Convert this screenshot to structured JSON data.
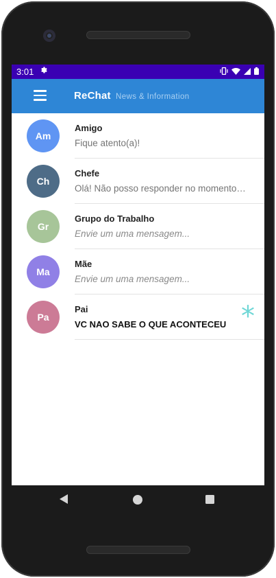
{
  "status_bar": {
    "time": "3:01",
    "settings_icon": "gear-icon",
    "icons": [
      "vibrate-icon",
      "wifi-icon",
      "signal-icon",
      "battery-icon"
    ]
  },
  "app_bar": {
    "menu_icon": "hamburger-menu-icon",
    "title": "ReChat",
    "subtitle": "News & Information",
    "color": "#2e86d6"
  },
  "chats": [
    {
      "initials": "Am",
      "name": "Amigo",
      "message": "Fique atento(a)!",
      "avatar_color": "#5f95f3",
      "style": "normal"
    },
    {
      "initials": "Ch",
      "name": "Chefe",
      "message": "Olá! Não posso responder no momento,...",
      "avatar_color": "#4e6c87",
      "style": "normal"
    },
    {
      "initials": "Gr",
      "name": "Grupo do Trabalho",
      "message": "Envie um uma mensagem...",
      "avatar_color": "#a7c599",
      "style": "italic"
    },
    {
      "initials": "Ma",
      "name": "Mãe",
      "message": "Envie um uma mensagem...",
      "avatar_color": "#9080e6",
      "style": "italic"
    },
    {
      "initials": "Pa",
      "name": "Pai",
      "message": "VC NAO SABE O QUE ACONTECEU",
      "avatar_color": "#cc7b96",
      "style": "unread",
      "badge": "*"
    }
  ],
  "nav_bar": {
    "back_icon": "back-triangle-icon",
    "home_icon": "home-circle-icon",
    "recents_icon": "recents-square-icon"
  }
}
